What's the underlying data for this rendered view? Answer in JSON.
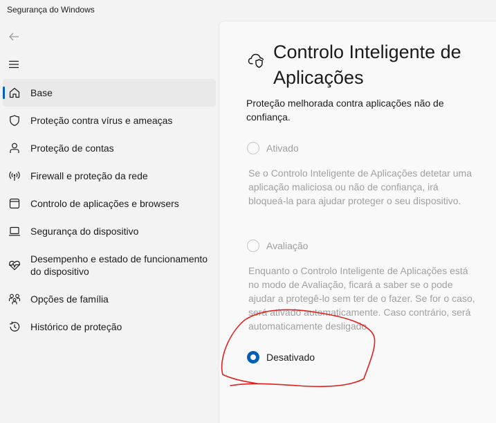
{
  "window": {
    "title": "Segurança do Windows"
  },
  "nav": {
    "items": [
      {
        "label": "Base",
        "icon": "home-icon",
        "selected": true
      },
      {
        "label": "Proteção contra vírus e ameaças",
        "icon": "shield-icon"
      },
      {
        "label": "Proteção de contas",
        "icon": "person-icon"
      },
      {
        "label": "Firewall e proteção da rede",
        "icon": "wifi-signal-icon"
      },
      {
        "label": "Controlo de aplicações e browsers",
        "icon": "app-window-icon"
      },
      {
        "label": "Segurança do dispositivo",
        "icon": "laptop-icon"
      },
      {
        "label": "Desempenho e estado de funcionamento do dispositivo",
        "icon": "heart-pulse-icon"
      },
      {
        "label": "Opções de família",
        "icon": "family-icon"
      },
      {
        "label": "Histórico de proteção",
        "icon": "history-icon"
      }
    ]
  },
  "main": {
    "title": "Controlo Inteligente de Aplicações",
    "description": "Proteção melhorada contra aplicações não de confiança.",
    "options": [
      {
        "label": "Ativado",
        "selected": false,
        "enabled": false,
        "description": "Se o Controlo Inteligente de Aplicações detetar uma aplicação maliciosa ou não de confiança, irá bloqueá-la para ajudar proteger o seu dispositivo."
      },
      {
        "label": "Avaliação",
        "selected": false,
        "enabled": false,
        "description": "Enquanto o Controlo Inteligente de Aplicações está no modo de Avaliação, ficará a saber se o pode ajudar a protegê-lo sem ter de o fazer. Se for o caso, será ativado automaticamente. Caso contrário, será automaticamente desligado."
      },
      {
        "label": "Desativado",
        "selected": true,
        "enabled": true
      }
    ]
  },
  "colors": {
    "accent": "#005fb8",
    "annotation": "#e0201c"
  }
}
